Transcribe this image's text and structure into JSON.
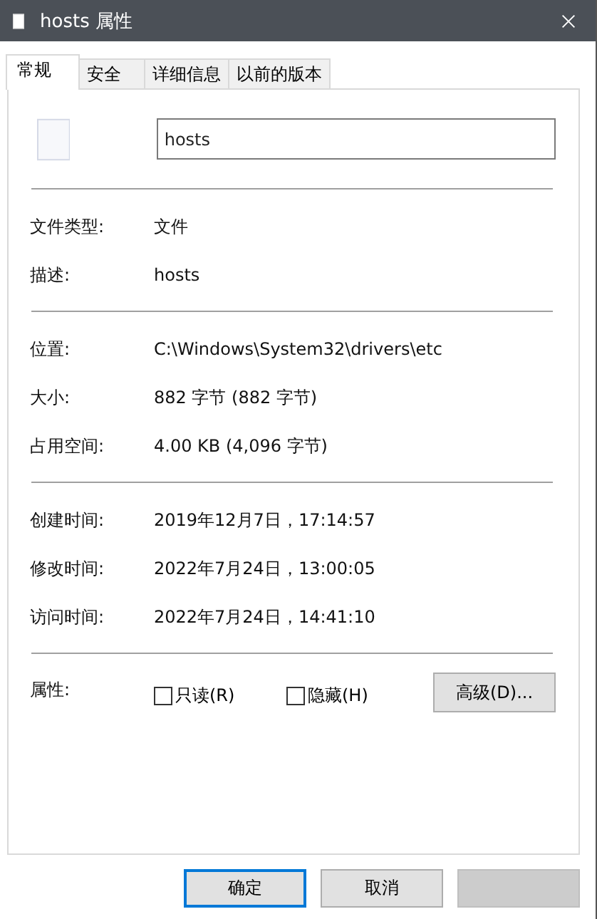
{
  "window": {
    "title": "hosts 属性"
  },
  "tabs": [
    {
      "label": "常规",
      "selected": true
    },
    {
      "label": "安全",
      "selected": false
    },
    {
      "label": "详细信息",
      "selected": false
    },
    {
      "label": "以前的版本",
      "selected": false
    }
  ],
  "name_field": {
    "value": "hosts"
  },
  "sections": [
    [
      {
        "label": "文件类型:",
        "value": "文件"
      },
      {
        "label": "描述:",
        "value": "hosts"
      }
    ],
    [
      {
        "label": "位置:",
        "value": "C:\\Windows\\System32\\drivers\\etc"
      },
      {
        "label": "大小:",
        "value": "882 字节 (882 字节)"
      },
      {
        "label": "占用空间:",
        "value": "4.00 KB (4,096 字节)"
      }
    ],
    [
      {
        "label": "创建时间:",
        "value": "2019年12月7日，17:14:57"
      },
      {
        "label": "修改时间:",
        "value": "2022年7月24日，13:00:05"
      },
      {
        "label": "访问时间:",
        "value": "2022年7月24日，14:41:10"
      }
    ]
  ],
  "attributes": {
    "label": "属性:",
    "checkboxes": [
      {
        "label": "只读(R)",
        "checked": false
      },
      {
        "label": "隐藏(H)",
        "checked": false
      }
    ],
    "advanced_button": "高级(D)..."
  },
  "buttons": [
    {
      "label": "确定",
      "default": true,
      "disabled": false
    },
    {
      "label": "取消",
      "default": false,
      "disabled": false
    },
    {
      "default": false,
      "disabled": true
    }
  ]
}
